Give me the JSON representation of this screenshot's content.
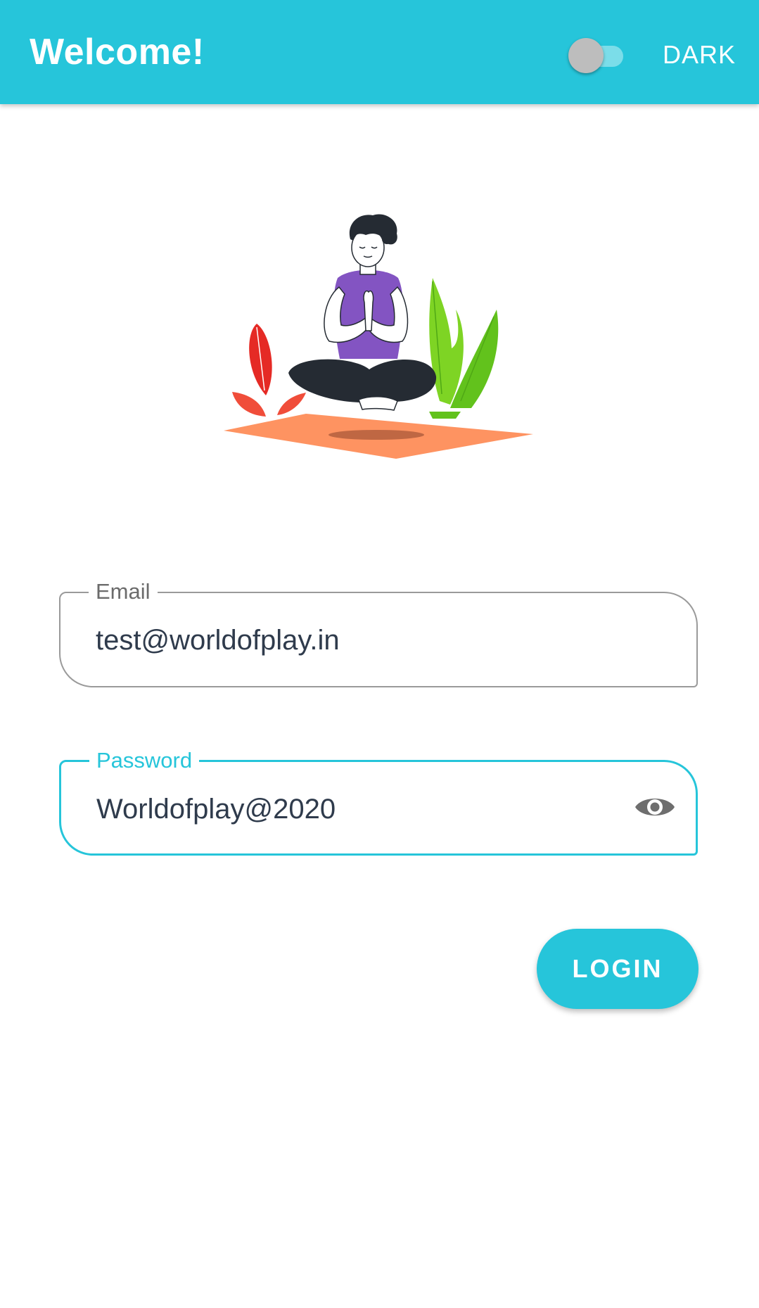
{
  "app_bar": {
    "title": "Welcome!",
    "theme_toggle": {
      "label": "DARK",
      "on": false
    }
  },
  "illustration": {
    "icon": "meditation-illustration"
  },
  "form": {
    "email": {
      "label": "Email",
      "value": "test@worldofplay.in"
    },
    "password": {
      "label": "Password",
      "value": "Worldofplay@2020",
      "icon": "eye-icon"
    },
    "login_label": "LOGIN"
  },
  "colors": {
    "primary": "#26C5DA",
    "text": "#2F3B4C",
    "outline": "#9A9A9A"
  }
}
